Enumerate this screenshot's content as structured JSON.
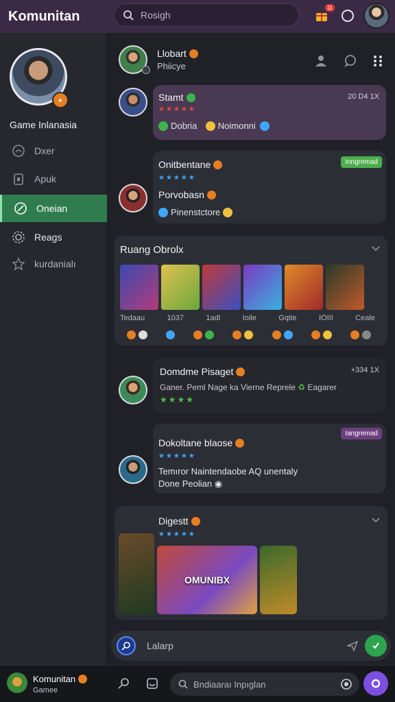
{
  "app": {
    "title": "Komunitan"
  },
  "search": {
    "placeholder": "Rosigh"
  },
  "notifications": {
    "count": "11"
  },
  "sidebar": {
    "profile_name": "Game Inlanasia",
    "items": [
      {
        "label": "Dxer",
        "icon": "chat-bubble-icon"
      },
      {
        "label": "Apuk",
        "icon": "clipboard-icon"
      },
      {
        "label": "Oneian",
        "icon": "compass-icon",
        "active": true
      },
      {
        "label": "Reags",
        "icon": "gear-icon"
      },
      {
        "label": "kurdanialı",
        "icon": "star-outline-icon"
      }
    ]
  },
  "header_user": {
    "name": "Llobart",
    "status": "Phiicye"
  },
  "posts": [
    {
      "name": "Stamt",
      "time": "20 D4 1X",
      "chips": [
        "Dobria",
        "Noimonni"
      ],
      "stars": "★★★★★"
    },
    {
      "name": "Onitbentane",
      "badge": "Inngremad",
      "stars": "★★★★★",
      "sub_name": "Porvobasn",
      "chip": "Pinenstctore"
    },
    {
      "name": "Domdme Pisaget",
      "time": "+334 1X",
      "text": "Ganer. Peml Nage ka Vierne Reprele",
      "text_tail": "Eagarer",
      "stars": "★★★★"
    },
    {
      "name": "Dokoltane blaose",
      "badge": "Iangremad",
      "stars": "★★★★★",
      "text_line1": "Temıror Naintendaobe AQ unentaly",
      "text_line2": "Done Peolian"
    },
    {
      "name": "Digestt",
      "stars": "★★★★★",
      "banner_text": "OMUNIBX"
    }
  ],
  "ruang": {
    "title": "Ruang Obrolx",
    "tiles": [
      "Tedaau",
      "1037",
      "1adl",
      "Ioile",
      "Gqtie",
      "IOIII",
      "Ceale"
    ]
  },
  "composer": {
    "placeholder": "Lalarp"
  },
  "bottom": {
    "app_name": "Komunitan",
    "app_sub": "Gamee",
    "search_placeholder": "Bndiaaraı Inpıglan"
  },
  "colors": {
    "accent_green": "#2f7d4f",
    "accent_purple": "#7b4fe0",
    "topbar": "#3b2a45",
    "star_blue": "#3fa7ff",
    "star_red": "#e04a4a",
    "star_green": "#4cc24c"
  }
}
